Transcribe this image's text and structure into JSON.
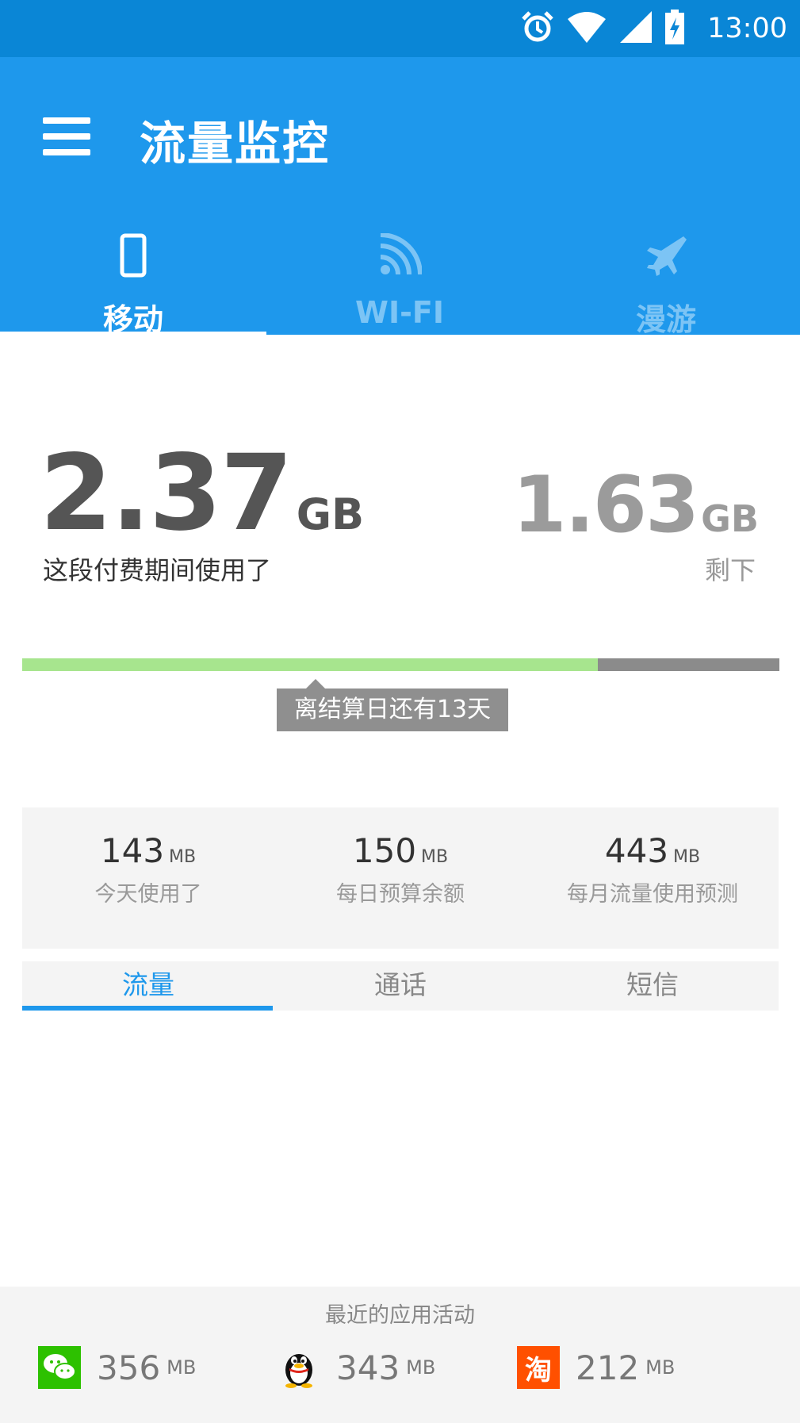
{
  "status_bar": {
    "time": "13:00",
    "icons": [
      "alarm-icon",
      "wifi-signal-icon",
      "cell-signal-icon",
      "battery-charging-icon"
    ]
  },
  "app_bar": {
    "title": "流量监控",
    "menu_icon": "hamburger-menu-icon"
  },
  "tabs": [
    {
      "label": "移动",
      "icon": "phone-icon",
      "active": true
    },
    {
      "label": "WI-FI",
      "icon": "wifi-icon",
      "active": false
    },
    {
      "label": "漫游",
      "icon": "airplane-icon",
      "active": false
    }
  ],
  "usage": {
    "used_value": "2.37",
    "used_unit": "GB",
    "used_label": "这段付费期间使用了",
    "remaining_value": "1.63",
    "remaining_unit": "GB",
    "remaining_label": "剩下",
    "used_fraction": 0.76,
    "tooltip": "离结算日还有13天"
  },
  "stats": [
    {
      "value": "143",
      "unit": "MB",
      "label": "今天使用了"
    },
    {
      "value": "150",
      "unit": "MB",
      "label": "每日预算余额"
    },
    {
      "value": "443",
      "unit": "MB",
      "label": "每月流量使用预测"
    }
  ],
  "sub_tabs": [
    {
      "label": "流量",
      "active": true
    },
    {
      "label": "通话",
      "active": false
    },
    {
      "label": "短信",
      "active": false
    }
  ],
  "recent_apps": {
    "title": "最近的应用活动",
    "apps": [
      {
        "icon": "wechat-icon",
        "value": "356",
        "unit": "MB"
      },
      {
        "icon": "qq-penguin-icon",
        "value": "343",
        "unit": "MB"
      },
      {
        "icon": "taobao-icon",
        "value": "212",
        "unit": "MB",
        "logo_text": "淘"
      }
    ]
  },
  "colors": {
    "status_bar": "#0a86d6",
    "app_bar": "#1e98ec",
    "progress_used": "#a7e58e",
    "progress_remaining": "#8b8b8b",
    "accent": "#1e98ec"
  }
}
